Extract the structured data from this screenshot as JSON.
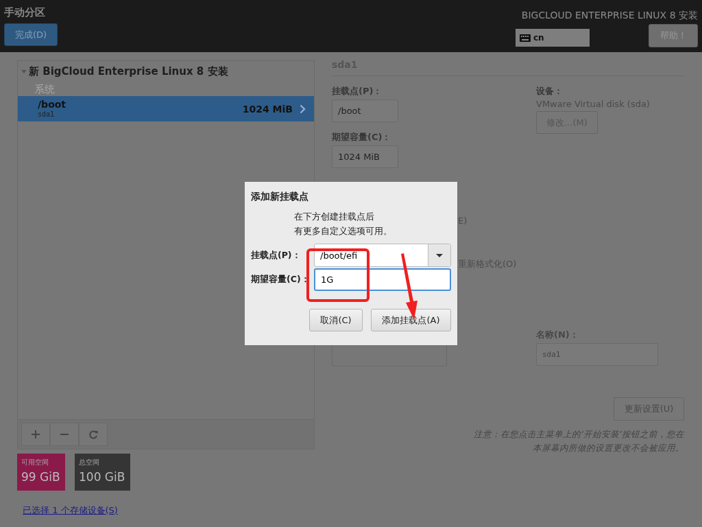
{
  "header": {
    "title": "手动分区",
    "done_button": "完成(D)",
    "product": "BIGCLOUD ENTERPRISE LINUX 8 安装",
    "keyboard": "cn",
    "help_button": "帮助！"
  },
  "tree": {
    "label": "新 BigCloud Enterprise Linux 8 安装",
    "expanded": true,
    "groups": [
      {
        "label": "系统",
        "items": [
          {
            "mount": "/boot",
            "device": "sda1",
            "size": "1024 MiB",
            "selected": true
          }
        ]
      }
    ]
  },
  "space": [
    {
      "label": "可用空间",
      "value": "99 GiB",
      "color": "#8a1a4a"
    },
    {
      "label": "总空间",
      "value": "100 GiB",
      "color": "#353535"
    }
  ],
  "storage_link": "已选择 1 个存储设备(S)",
  "details": {
    "title": "sda1",
    "mount_label": "挂载点(P)：",
    "mount_value": "/boot",
    "capacity_label": "期望容量(C)：",
    "capacity_value": "1024 MiB",
    "device_label": "设备：",
    "device_value": "VMware Virtual disk (sda)",
    "modify_button": "修改...(M)",
    "fragment": "E)",
    "reformat_label": "重新格式化(O)",
    "name_label": "名称(N)：",
    "name_value": "sda1",
    "update_button": "更新设置(U)",
    "note_lines": [
      "注意：在您点击主菜单上的‘开始安装’按钮之前，您在",
      "本屏幕内所做的设置更改不会被应用。"
    ]
  },
  "dialog": {
    "title": "添加新挂载点",
    "message_lines": [
      "在下方创建挂载点后",
      "有更多自定义选项可用。"
    ],
    "mount_label": "挂载点(P)：",
    "mount_value": "/boot/efi",
    "capacity_label": "期望容量(C)：",
    "capacity_value": "1G",
    "capacity_focused": true,
    "buttons": [
      {
        "label": "取消(C)"
      },
      {
        "label": "添加挂载点(A)"
      }
    ]
  }
}
